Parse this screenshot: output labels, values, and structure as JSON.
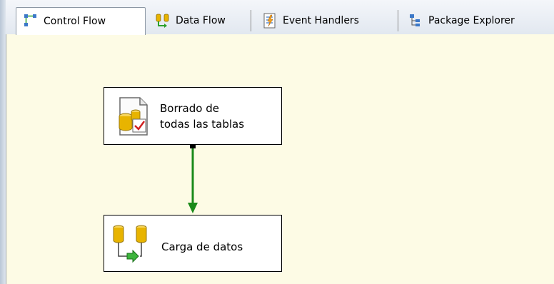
{
  "tabs": [
    {
      "label": "Control Flow",
      "active": true,
      "icon": "control-flow-icon"
    },
    {
      "label": "Data Flow",
      "active": false,
      "icon": "data-flow-icon"
    },
    {
      "label": "Event Handlers",
      "active": false,
      "icon": "event-handlers-icon"
    },
    {
      "label": "Package Explorer",
      "active": false,
      "icon": "package-explorer-icon"
    }
  ],
  "canvas": {
    "background": "#fdfbe5",
    "tasks": [
      {
        "label_line1": "Borrado de",
        "label_line2": "todas las tablas",
        "icon": "execute-sql-task-icon"
      },
      {
        "label": "Carga de datos",
        "icon": "data-flow-task-icon"
      }
    ],
    "connector": {
      "color": "#1a8a1a",
      "meaning": "success-precedence"
    }
  }
}
